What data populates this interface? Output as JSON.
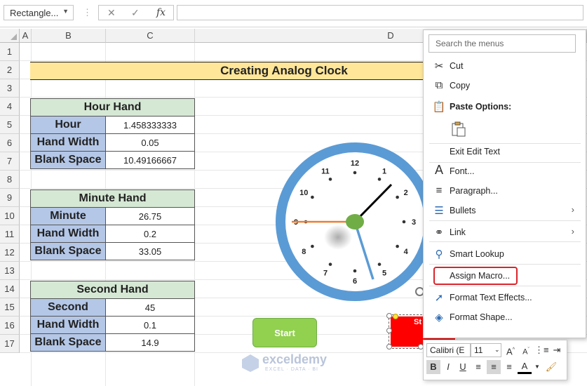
{
  "formula_bar": {
    "name_box": "Rectangle...",
    "cancel_icon": "✕",
    "enter_icon": "✓",
    "fx_label": "fx",
    "formula": ""
  },
  "columns": [
    "A",
    "B",
    "C",
    "D"
  ],
  "rows": [
    "1",
    "2",
    "3",
    "4",
    "5",
    "6",
    "7",
    "8",
    "9",
    "10",
    "11",
    "12",
    "13",
    "14",
    "15",
    "16",
    "17"
  ],
  "title": "Creating Analog Clock",
  "hour_table": {
    "header": "Hour Hand",
    "rows": [
      {
        "label": "Hour",
        "value": "1.458333333"
      },
      {
        "label": "Hand Width",
        "value": "0.05"
      },
      {
        "label": "Blank Space",
        "value": "10.49166667"
      }
    ]
  },
  "minute_table": {
    "header": "Minute Hand",
    "rows": [
      {
        "label": "Minute",
        "value": "26.75"
      },
      {
        "label": "Hand Width",
        "value": "0.2"
      },
      {
        "label": "Blank Space",
        "value": "33.05"
      }
    ]
  },
  "second_table": {
    "header": "Second Hand",
    "rows": [
      {
        "label": "Second",
        "value": "45"
      },
      {
        "label": "Hand Width",
        "value": "0.1"
      },
      {
        "label": "Blank Space",
        "value": "14.9"
      }
    ]
  },
  "clock": {
    "numbers": [
      "12",
      "1",
      "2",
      "3",
      "4",
      "5",
      "6",
      "7",
      "8",
      "9",
      "10",
      "11"
    ],
    "hour_value": 1.458333333,
    "minute_value": 26.75,
    "second_value": 45,
    "colors": {
      "ring": "#5b9bd5",
      "hour": "#000000",
      "minute": "#5b9bd5",
      "second": "#ed7d31",
      "center": "#70ad47"
    }
  },
  "start_button": "Start",
  "red_shape_text": "St",
  "context_menu": {
    "search_placeholder": "Search the menus",
    "items": [
      {
        "label": "Cut",
        "icon": "scissors-icon"
      },
      {
        "label": "Copy",
        "icon": "copy-icon"
      },
      {
        "label": "Paste Options:",
        "icon": "paste-icon"
      },
      {
        "label": "Exit Edit Text",
        "icon": ""
      },
      {
        "label": "Font...",
        "icon": "font-icon"
      },
      {
        "label": "Paragraph...",
        "icon": "paragraph-icon"
      },
      {
        "label": "Bullets",
        "icon": "bullets-icon"
      },
      {
        "label": "Link",
        "icon": "link-icon"
      },
      {
        "label": "Smart Lookup",
        "icon": "search-icon"
      },
      {
        "label": "Assign Macro...",
        "icon": ""
      },
      {
        "label": "Format Text Effects...",
        "icon": "text-effects-icon"
      },
      {
        "label": "Format Shape...",
        "icon": "format-shape-icon"
      }
    ]
  },
  "mini_toolbar": {
    "font": "Calibri (E",
    "size": "11",
    "bold": "B",
    "italic": "I",
    "underline": "U",
    "grow": "A",
    "shrink": "A",
    "font_color": "A"
  },
  "watermark": {
    "name": "exceldemy",
    "tagline": "EXCEL · DATA · BI"
  }
}
